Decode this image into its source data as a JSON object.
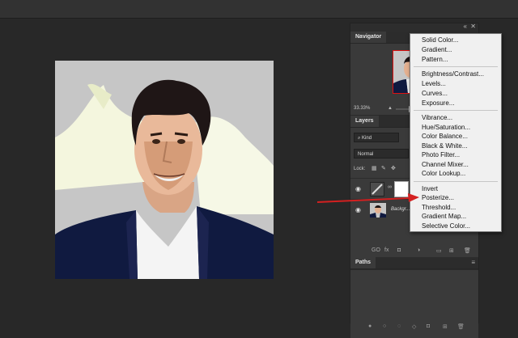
{
  "navigator": {
    "tab": "Navigator",
    "zoom": "33.33%"
  },
  "layers": {
    "tab": "Layers",
    "kind_filter": "Kind",
    "blend_mode": "Normal",
    "lock_label": "Lock:",
    "layer_name": "Backgr..."
  },
  "paths": {
    "tab": "Paths"
  },
  "adjustment_menu": {
    "items": [
      "Solid Color...",
      "Gradient...",
      "Pattern...",
      "Brightness/Contrast...",
      "Levels...",
      "Curves...",
      "Exposure...",
      "Vibrance...",
      "Hue/Saturation...",
      "Color Balance...",
      "Black & White...",
      "Photo Filter...",
      "Channel Mixer...",
      "Color Lookup...",
      "Invert",
      "Posterize...",
      "Threshold...",
      "Gradient Map...",
      "Selective Color..."
    ]
  },
  "annotation": {
    "arrow_color": "#d42020",
    "points_to": "Posterize..."
  },
  "colors": {
    "menu_bg": "#f0f0f0",
    "panel_bg": "#3a3a3a",
    "workspace_bg": "#282828",
    "selection_border": "#dd1111"
  }
}
